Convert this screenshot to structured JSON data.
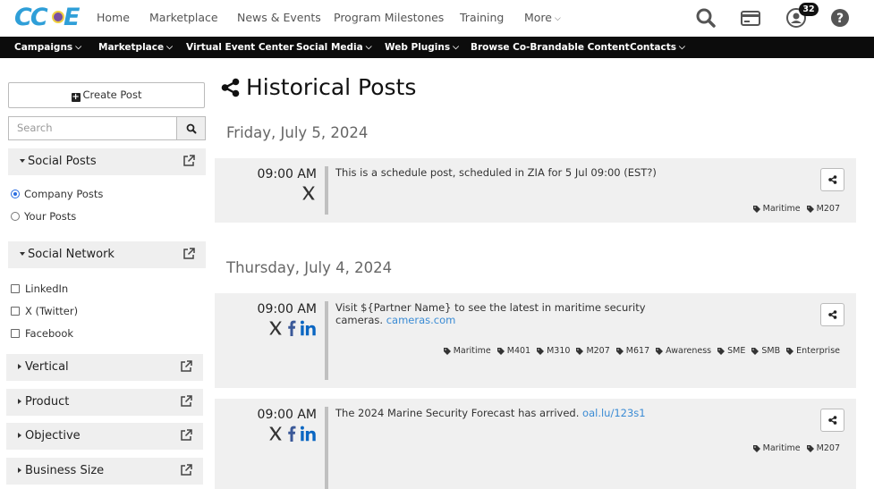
{
  "brand": {
    "logo_text": "CC"
  },
  "topnav": {
    "items": [
      "Home",
      "Marketplace",
      "News & Events",
      "Program Milestones",
      "Training",
      "More"
    ],
    "notifications_count": "32"
  },
  "subnav": {
    "items": [
      "Campaigns",
      "Marketplace",
      "Virtual Event Center",
      "Social Media",
      "Web Plugins",
      "Browse Co-Brandable Content",
      "Contacts"
    ]
  },
  "sidebar": {
    "create_post": "Create Post",
    "search_placeholder": "Search",
    "social_posts": {
      "label": "Social Posts",
      "options": [
        "Company Posts",
        "Your Posts"
      ],
      "selected": "Company Posts"
    },
    "social_network": {
      "label": "Social Network",
      "options": [
        "LinkedIn",
        "X (Twitter)",
        "Facebook"
      ]
    },
    "filters": [
      "Vertical",
      "Product",
      "Objective",
      "Business Size"
    ]
  },
  "main": {
    "title": "Historical Posts",
    "days": [
      {
        "date": "Friday, July 5, 2024",
        "posts": [
          {
            "time": "09:00 AM",
            "networks": [
              "x-icon"
            ],
            "text": "This is a schedule post, scheduled in ZIA for 5 Jul 09:00 (EST?)",
            "link": "",
            "tags": [
              "Maritime",
              "M207"
            ]
          }
        ]
      },
      {
        "date": "Thursday, July 4, 2024",
        "posts": [
          {
            "time": "09:00 AM",
            "networks": [
              "x-icon",
              "facebook-icon",
              "linkedin-icon"
            ],
            "text": "Visit  ${Partner Name} to see the latest in maritime security cameras.",
            "link": "cameras.com",
            "tags": [
              "Maritime",
              "M401",
              "M310",
              "M207",
              "M617",
              "Awareness",
              "SME",
              "SMB",
              "Enterprise"
            ]
          },
          {
            "time": "09:00 AM",
            "networks": [
              "x-icon",
              "facebook-icon",
              "linkedin-icon"
            ],
            "text": "The 2024 Marine Security Forecast has arrived.",
            "link": "oal.lu/123s1",
            "tags": [
              "Maritime",
              "M207"
            ]
          }
        ]
      }
    ]
  },
  "colors": {
    "accent": "#2f9fd8",
    "subnav_bg": "#0c0c0c",
    "link": "#3a8bd4",
    "facebook": "#3b5998",
    "linkedin": "#0a66c2"
  }
}
